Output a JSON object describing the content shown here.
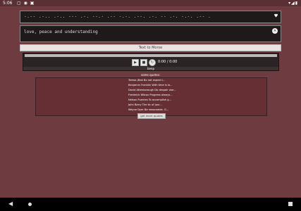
{
  "status": {
    "time": "5:06",
    "icons": "▢ ◉ ▣",
    "right_icons": "▾◢▮"
  },
  "morse": {
    "value": "-.-- .-.. .-.. --- .-. --.- .-- -.-. .--. .-. -- .-. -.-. .-- .",
    "icon": "heart-icon"
  },
  "input": {
    "value": "love, peace and understanding",
    "icon": "close-icon"
  },
  "convert": {
    "label": "Text to Morse"
  },
  "player": {
    "play_icon": "▶",
    "stop_icon": "■",
    "loop_icon": "↻",
    "progress_label": "0:00 / 0:00",
    "bottom_label": "beep"
  },
  "quotes": {
    "header": "some quotes:",
    "items": [
      "Teresa (Bak Bo not expect l...",
      "Benjamin Franklin With time is lo...",
      "David Attenborough Do despair wor...",
      "Frederick Wilcox Progress always...",
      "Nelson Puentes To accomplish g...",
      "John Barry The tic of jour...",
      "Wayne Dyer Be reasonable, G..."
    ],
    "more_label": "get more quotes"
  }
}
